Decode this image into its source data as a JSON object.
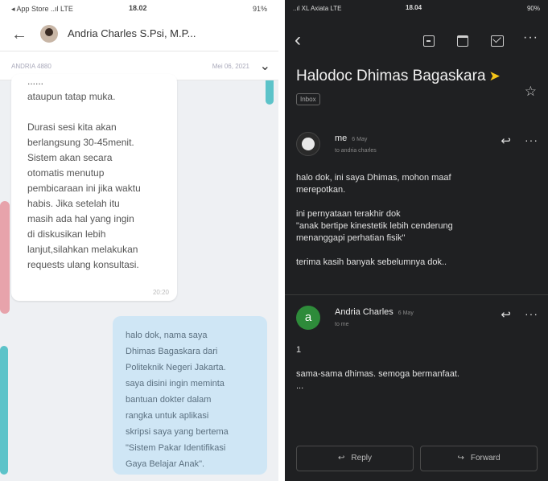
{
  "left_phone": {
    "status": {
      "carrier": "◂ App Store ..ıl LTE",
      "time": "18.02",
      "battery": "91%"
    },
    "header": {
      "back_icon": "back-arrow-icon",
      "contact_name": "Andria Charles S.Psi, M.P..."
    },
    "subheader": {
      "left_text": "ANDRIA 4880",
      "right_text": "Mei 06, 2021",
      "chevron_icon": "chevron-down-icon"
    },
    "incoming_message": {
      "text": "......\nataupun tatap muka.\n\nDurasi sesi kita akan\nberlangsung 30-45menit.\nSistem akan secara\notomatis menutup\npembicaraan ini jika waktu\nhabis. Jika setelah itu\nmasih ada hal yang ingin\ndi diskusikan lebih\nlanjut,silahkan melakukan\nrequests ulang konsultasi.",
      "time": "20:20"
    },
    "outgoing_message": {
      "text": "halo dok, nama saya\nDhimas Bagaskara dari\nPoliteknik Negeri Jakarta.\nsaya disini ingin meminta\nbantuan dokter dalam\nrangka untuk aplikasi\nskripsi saya yang bertema\n\"Sistem Pakar Identifikasi\nGaya Belajar Anak\"."
    },
    "accent_colors": {
      "outgoing_bubble": "#cfe6f5",
      "background": "#eef0f3"
    }
  },
  "right_phone": {
    "status": {
      "carrier": "..ıl XL Axiata LTE",
      "time": "18.04",
      "battery": "90%"
    },
    "toolbar": {
      "back_icon": "back-chevron-icon",
      "icons": [
        "archive-icon",
        "trash-icon",
        "mail-icon",
        "more-vert-icon"
      ]
    },
    "subject": "Halodoc Dhimas Bagaskara",
    "label": "Inbox",
    "message1": {
      "sender": "me",
      "date": "6 May",
      "to": "to andria charles",
      "body": "halo dok,  ini saya Dhimas, mohon maaf\nmerepotkan.\n\nini pernyataan terakhir dok\n\"anak bertipe kinestetik lebih cenderung\nmenanggapi perhatian fisik\"\n\nterima kasih banyak sebelumnya dok.."
    },
    "message2": {
      "sender": "Andria Charles",
      "avatar_letter": "a",
      "date": "6 May",
      "to": "to me",
      "body": "1\n\nsama-sama dhimas. semoga bermanfaat.\n..."
    },
    "actions": {
      "reply": "Reply",
      "forward": "Forward"
    },
    "accent_colors": {
      "background": "#1f2022",
      "avatar_green": "#2e8b3a",
      "important_marker": "#f5c518"
    }
  }
}
